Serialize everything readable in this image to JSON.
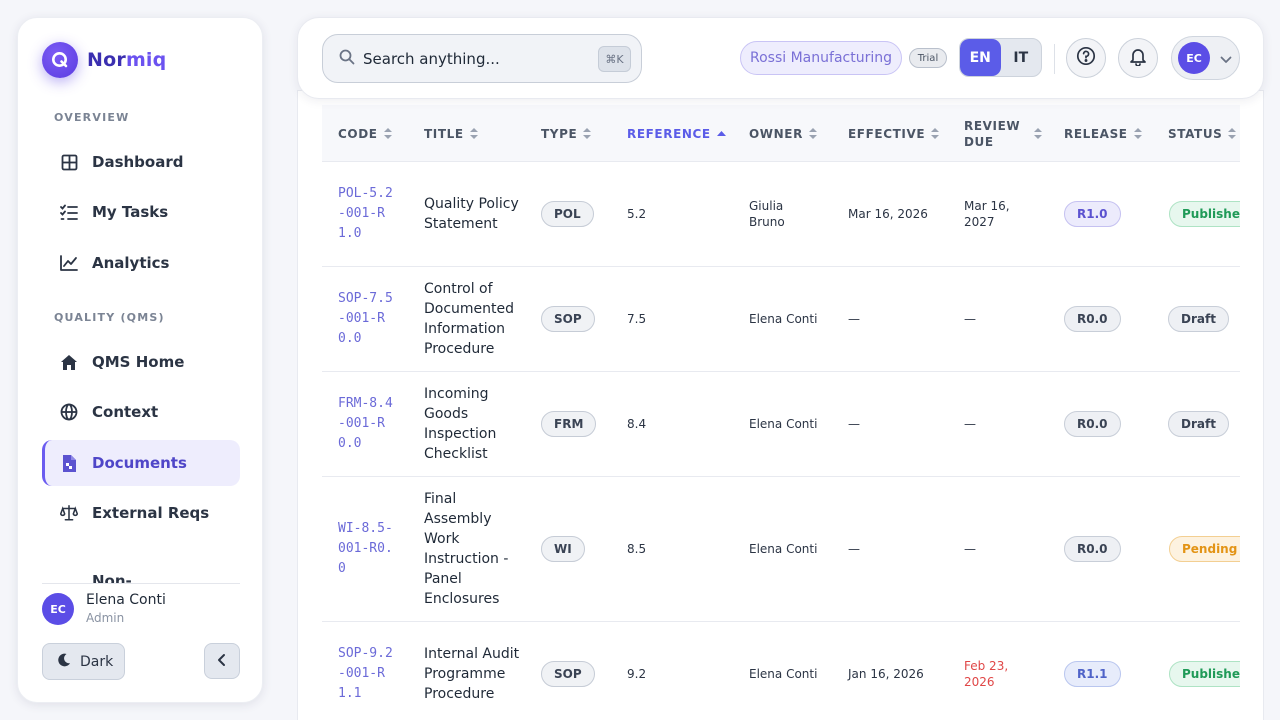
{
  "brand": {
    "name_part1": "Nor",
    "name_part2": "miq"
  },
  "sidebar": {
    "section_overview": "OVERVIEW",
    "section_quality": "QUALITY (QMS)",
    "items": [
      {
        "label": "Dashboard"
      },
      {
        "label": "My Tasks"
      },
      {
        "label": "Analytics"
      },
      {
        "label": "QMS Home"
      },
      {
        "label": "Context"
      },
      {
        "label": "Documents"
      },
      {
        "label": "External Reqs"
      },
      {
        "label": "Non-"
      }
    ],
    "user": {
      "initials": "EC",
      "name": "Elena Conti",
      "role": "Admin"
    },
    "theme_label": "Dark"
  },
  "header": {
    "search_placeholder": "Search anything...",
    "shortcut": "⌘K",
    "org": "Rossi Manufacturing",
    "plan": "Trial",
    "lang_en": "EN",
    "lang_it": "IT",
    "avatar_initials": "EC"
  },
  "table": {
    "columns": {
      "code": "CODE",
      "title": "TITLE",
      "type": "TYPE",
      "reference": "REFERENCE",
      "owner": "OWNER",
      "effective": "EFFECTIVE",
      "review_line1": "REVIEW",
      "review_line2": "DUE",
      "release": "RELEASE",
      "status": "STATUS"
    },
    "rows": [
      {
        "code": "POL-5.2-001-R1.0",
        "title": "Quality Policy Statement",
        "type": "POL",
        "reference": "5.2",
        "owner": "Giulia Bruno",
        "effective": "Mar 16, 2026",
        "review_due": "Mar 16, 2027",
        "release": "R1.0",
        "status": "Published"
      },
      {
        "code": "SOP-7.5-001-R0.0",
        "title": "Control of Documented Information Procedure",
        "type": "SOP",
        "reference": "7.5",
        "owner": "Elena Conti",
        "effective": "—",
        "review_due": "—",
        "release": "R0.0",
        "status": "Draft"
      },
      {
        "code": "FRM-8.4-001-R0.0",
        "title": "Incoming Goods Inspection Checklist",
        "type": "FRM",
        "reference": "8.4",
        "owner": "Elena Conti",
        "effective": "—",
        "review_due": "—",
        "release": "R0.0",
        "status": "Draft"
      },
      {
        "code": "WI-8.5-001-R0.0",
        "title": "Final Assembly Work Instruction - Panel Enclosures",
        "type": "WI",
        "reference": "8.5",
        "owner": "Elena Conti",
        "effective": "—",
        "review_due": "—",
        "release": "R0.0",
        "status": "Pending Approval"
      },
      {
        "code": "SOP-9.2-001-R1.1",
        "title": "Internal Audit Programme Procedure",
        "type": "SOP",
        "reference": "9.2",
        "owner": "Elena Conti",
        "effective": "Jan 16, 2026",
        "review_due": "Feb 23, 2026",
        "release": "R1.1",
        "status": "Published"
      }
    ]
  },
  "colors": {
    "accent": "#5b5ce8",
    "brand": "#5a3be0",
    "published": "#1f9a57",
    "pending": "#e39416",
    "overdue": "#e04747"
  }
}
